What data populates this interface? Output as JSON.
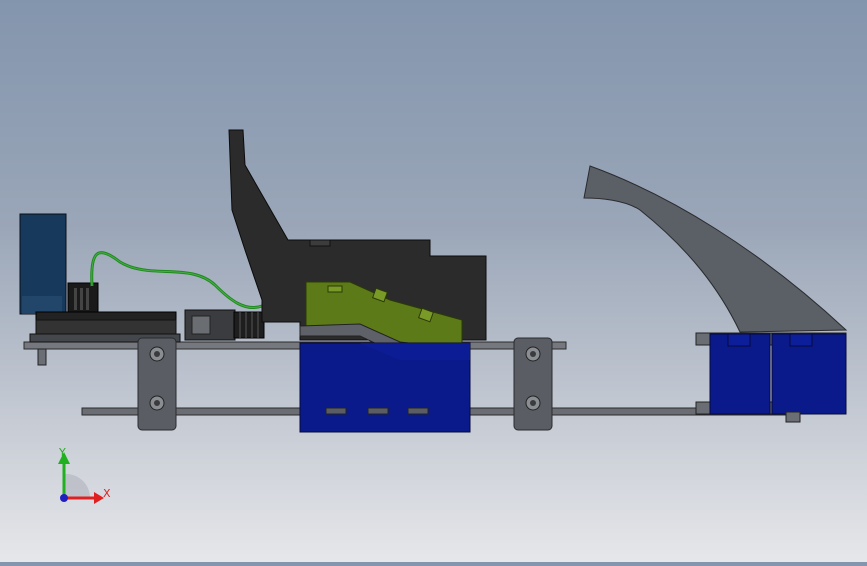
{
  "viewport": {
    "name": "cad-model-viewport",
    "view": "side elevation"
  },
  "triad": {
    "x_label": "X",
    "y_label": "Y",
    "x_color": "#e02020",
    "y_color": "#20b020",
    "z_color": "#2020c0"
  },
  "parts": {
    "enclosure_color": "#2b2b2b",
    "motor_color": "#0b1a8a",
    "bracket_color": "#5a5d64",
    "pedal_color": "#5b5f66",
    "board_color": "#173a5c",
    "cable_color": "#1f8a1f",
    "highlight_color": "#5d7a18"
  }
}
